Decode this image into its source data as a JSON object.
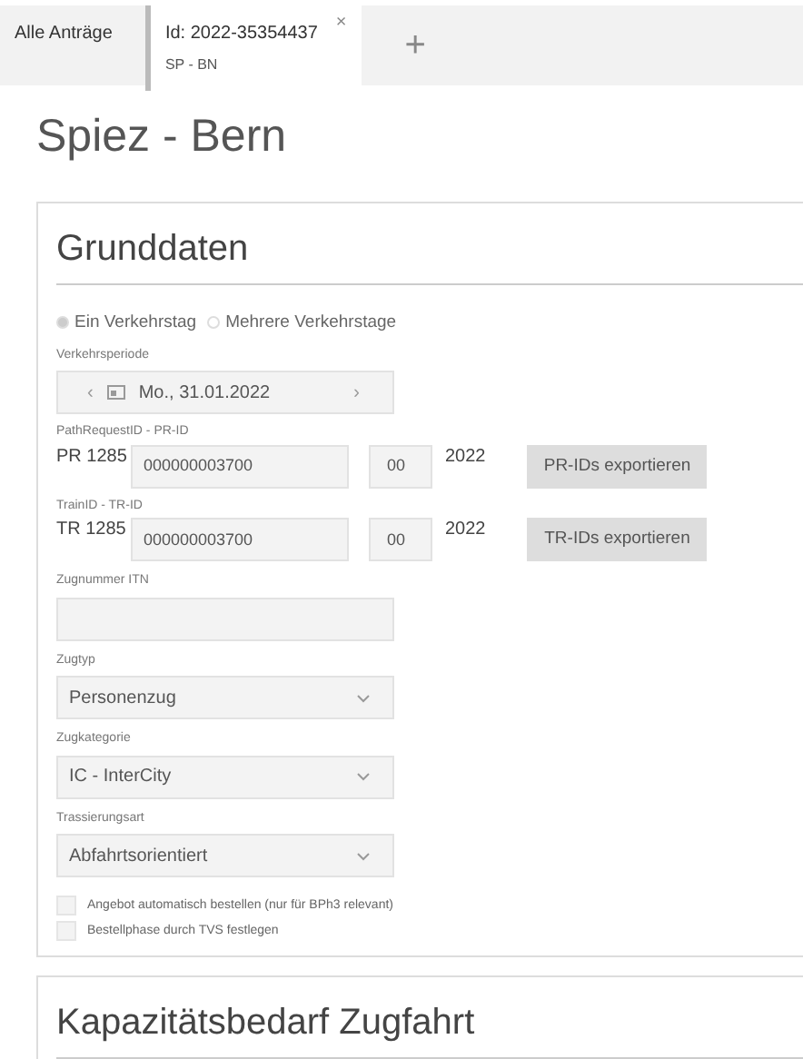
{
  "tabs": [
    {
      "label": "Alle Anträge",
      "selected": false
    },
    {
      "label": "Id: 2022-35354437",
      "sublabel": "SP - BN",
      "selected": true,
      "close": "×"
    }
  ],
  "add_tab": "+",
  "title": "Spiez - Bern",
  "sections": [
    {
      "title": "Grunddaten",
      "radios": [
        {
          "label": "Ein Verkehrstag",
          "selected": true
        },
        {
          "label": "Mehrere Verkehrstage",
          "selected": false
        }
      ],
      "period": {
        "label": "Verkehrsperiode",
        "prev": "‹",
        "value": "Mo., 31.01.2022",
        "next": "›"
      },
      "id_rows": [
        {
          "label": "PathRequestID - PR-ID",
          "prefix": "PR 1285",
          "core": "000000003700",
          "variant": "00",
          "year": "2022",
          "button": "PR-IDs exportieren"
        },
        {
          "label": "TrainID - TR-ID",
          "prefix": "TR 1285",
          "core": "000000003700",
          "variant": "00",
          "year": "2022",
          "button": "TR-IDs exportieren"
        }
      ],
      "fields": [
        {
          "kind": "text",
          "label": "Zugnummer ITN"
        },
        {
          "kind": "select",
          "label": "Zugtyp",
          "value": "Personenzug"
        },
        {
          "kind": "select",
          "label": "Zugkategorie",
          "value": "IC - InterCity"
        },
        {
          "kind": "select",
          "label": "Trassierungsart",
          "value": "Abfahrtsorientiert"
        }
      ],
      "checkboxes": [
        {
          "label": "Angebot automatisch bestellen (nur für BPh3 relevant)",
          "checked": false
        },
        {
          "label": "Bestellphase durch TVS festlegen",
          "checked": false
        }
      ]
    },
    {
      "title": "Kapazitätsbedarf Zugfahrt"
    }
  ]
}
